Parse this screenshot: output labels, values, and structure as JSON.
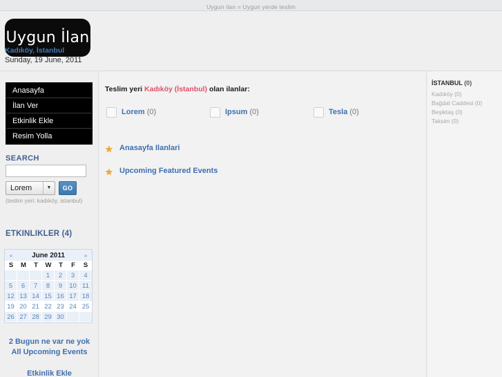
{
  "topbar": {
    "tagline": "Uygun ilan = Uygun yerde teslim"
  },
  "header": {
    "logo_text": "Uygun İlan",
    "place": "Kadıköy, İstanbul",
    "date": "Sunday, 19 June, 2011"
  },
  "nav": {
    "items": [
      {
        "label": "Anasayfa"
      },
      {
        "label": "İlan Ver"
      },
      {
        "label": "Etkinlik Ekle"
      },
      {
        "label": "Resim Yolla"
      }
    ]
  },
  "search": {
    "title": "SEARCH",
    "value": "",
    "placeholder": "",
    "select_value": "Lorem",
    "select_arrow": "▼",
    "go_label": "GO",
    "hint": "(teslim yeri: kadıköy, istanbul)"
  },
  "events": {
    "title": "ETKINLIKLER (4)",
    "calendar": {
      "prev_icon": "«",
      "next_icon": "»",
      "title": "June 2011",
      "dows": [
        "S",
        "M",
        "T",
        "W",
        "T",
        "F",
        "S"
      ],
      "weeks": [
        {
          "current": false,
          "days": [
            "",
            "",
            "",
            "1",
            "2",
            "3",
            "4"
          ]
        },
        {
          "current": false,
          "days": [
            "5",
            "6",
            "7",
            "8",
            "9",
            "10",
            "11"
          ]
        },
        {
          "current": false,
          "days": [
            "12",
            "13",
            "14",
            "15",
            "16",
            "17",
            "18"
          ]
        },
        {
          "current": true,
          "days": [
            "19",
            "20",
            "21",
            "22",
            "23",
            "24",
            "25"
          ]
        },
        {
          "current": false,
          "days": [
            "26",
            "27",
            "28",
            "29",
            "30",
            "",
            ""
          ]
        }
      ]
    },
    "links": [
      {
        "label": "2 Bugun ne var ne yok"
      },
      {
        "label": "All Upcoming Events"
      },
      {
        "label": "Etkinlik Ekle"
      }
    ]
  },
  "main": {
    "heading_pre": "Teslim yeri ",
    "heading_place": "Kadıköy (İstanbul)",
    "heading_post": " olan ilanlar:",
    "categories": [
      {
        "label": "Lorem",
        "count": "(0)"
      },
      {
        "label": "Ipsum",
        "count": "(0)"
      },
      {
        "label": "Tesla",
        "count": "(0)"
      }
    ],
    "featured": [
      {
        "icon": "star-icon",
        "glyph": "★",
        "label": "Anasayfa Ilanlari"
      },
      {
        "icon": "star-icon",
        "glyph": "★",
        "label": "Upcoming Featured Events"
      }
    ]
  },
  "right": {
    "title": "İSTANBUL",
    "title_count": "(0)",
    "items": [
      {
        "label": "Kadıköy (0)"
      },
      {
        "label": "Bağdat Caddesi (0)"
      },
      {
        "label": "Beşiktaş (0)"
      },
      {
        "label": "Taksim (0)"
      }
    ]
  },
  "colors": {
    "link": "#3f6fae",
    "accent_pink": "#e2506a",
    "nav_bg": "#000000",
    "go_button": "#3b79b0",
    "calendar_bg": "#eaf0f8"
  }
}
